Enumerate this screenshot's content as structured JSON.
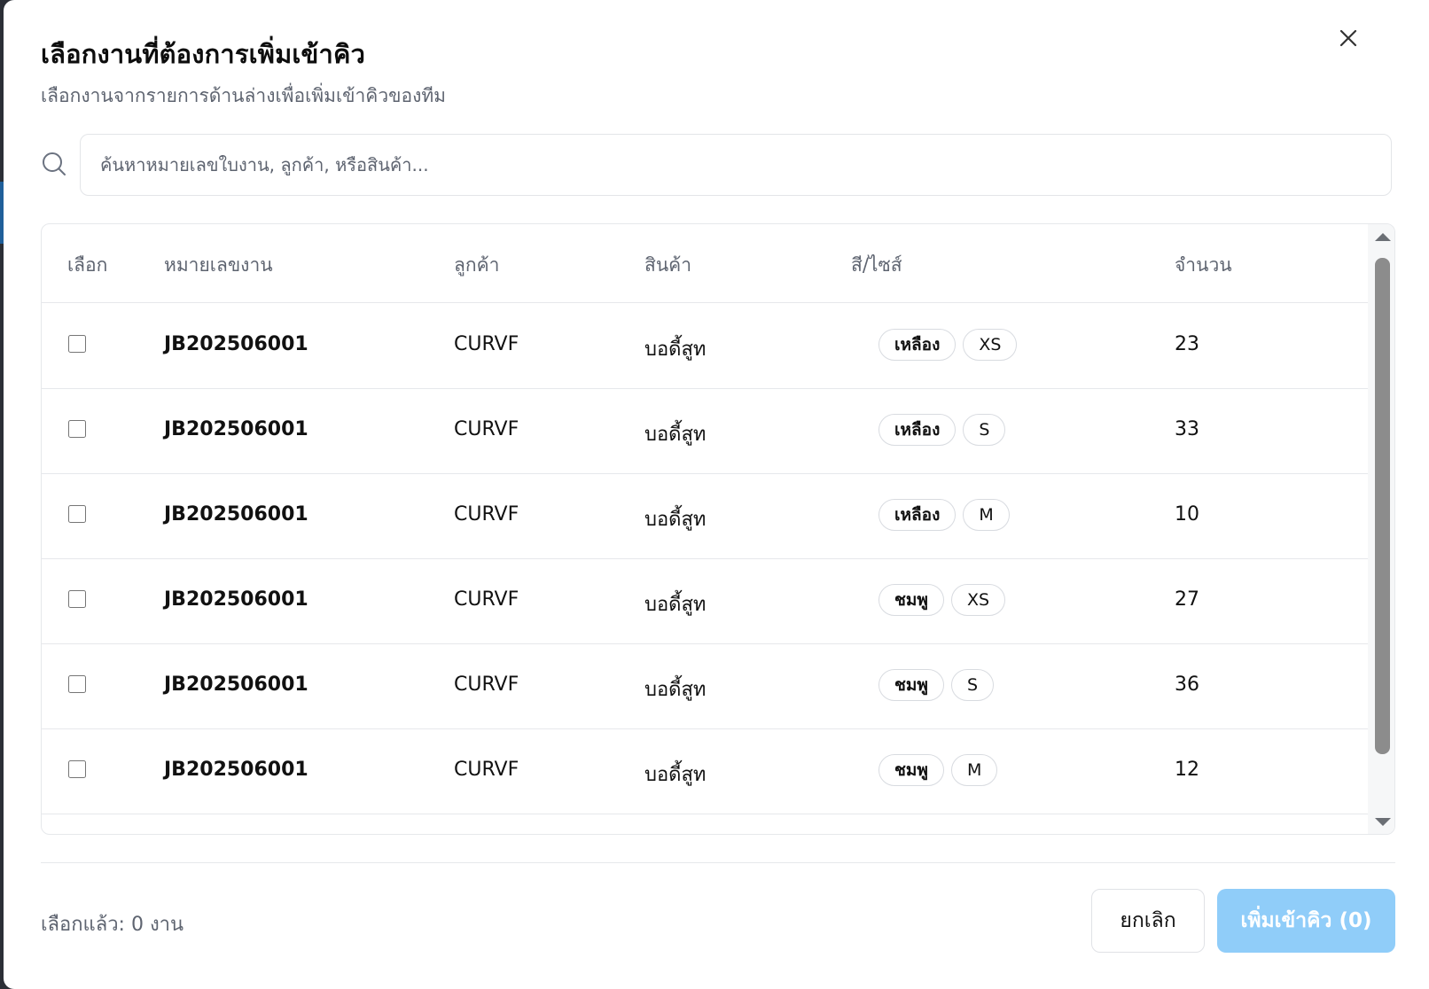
{
  "dialog": {
    "title": "เลือกงานที่ต้องการเพิ่มเข้าคิว",
    "subtitle": "เลือกงานจากรายการด้านล่างเพื่อเพิ่มเข้าคิวของทีม",
    "close_icon": "close-icon"
  },
  "search": {
    "placeholder": "ค้นหาหมายเลขใบงาน, ลูกค้า, หรือสินค้า...",
    "value": "",
    "icon": "search-icon"
  },
  "table": {
    "headers": {
      "select": "เลือก",
      "job_number": "หมายเลขงาน",
      "customer": "ลูกค้า",
      "product": "สินค้า",
      "color_size": "สี/ไซส์",
      "quantity": "จำนวน"
    },
    "rows": [
      {
        "checked": false,
        "job": "JB202506001",
        "customer": "CURVF",
        "product": "บอดี้สูท",
        "color": "เหลือง",
        "size": "XS",
        "qty": "23"
      },
      {
        "checked": false,
        "job": "JB202506001",
        "customer": "CURVF",
        "product": "บอดี้สูท",
        "color": "เหลือง",
        "size": "S",
        "qty": "33"
      },
      {
        "checked": false,
        "job": "JB202506001",
        "customer": "CURVF",
        "product": "บอดี้สูท",
        "color": "เหลือง",
        "size": "M",
        "qty": "10"
      },
      {
        "checked": false,
        "job": "JB202506001",
        "customer": "CURVF",
        "product": "บอดี้สูท",
        "color": "ชมพู",
        "size": "XS",
        "qty": "27"
      },
      {
        "checked": false,
        "job": "JB202506001",
        "customer": "CURVF",
        "product": "บอดี้สูท",
        "color": "ชมพู",
        "size": "S",
        "qty": "36"
      },
      {
        "checked": false,
        "job": "JB202506001",
        "customer": "CURVF",
        "product": "บอดี้สูท",
        "color": "ชมพู",
        "size": "M",
        "qty": "12"
      }
    ]
  },
  "footer": {
    "selected_label": "เลือกแล้ว: 0 งาน",
    "cancel_label": "ยกเลิก",
    "add_label": "เพิ่มเข้าคิว (0)"
  },
  "colors": {
    "primary_disabled": "#90cdf9",
    "muted_text": "#5e6470",
    "border": "#e6e8eb"
  }
}
